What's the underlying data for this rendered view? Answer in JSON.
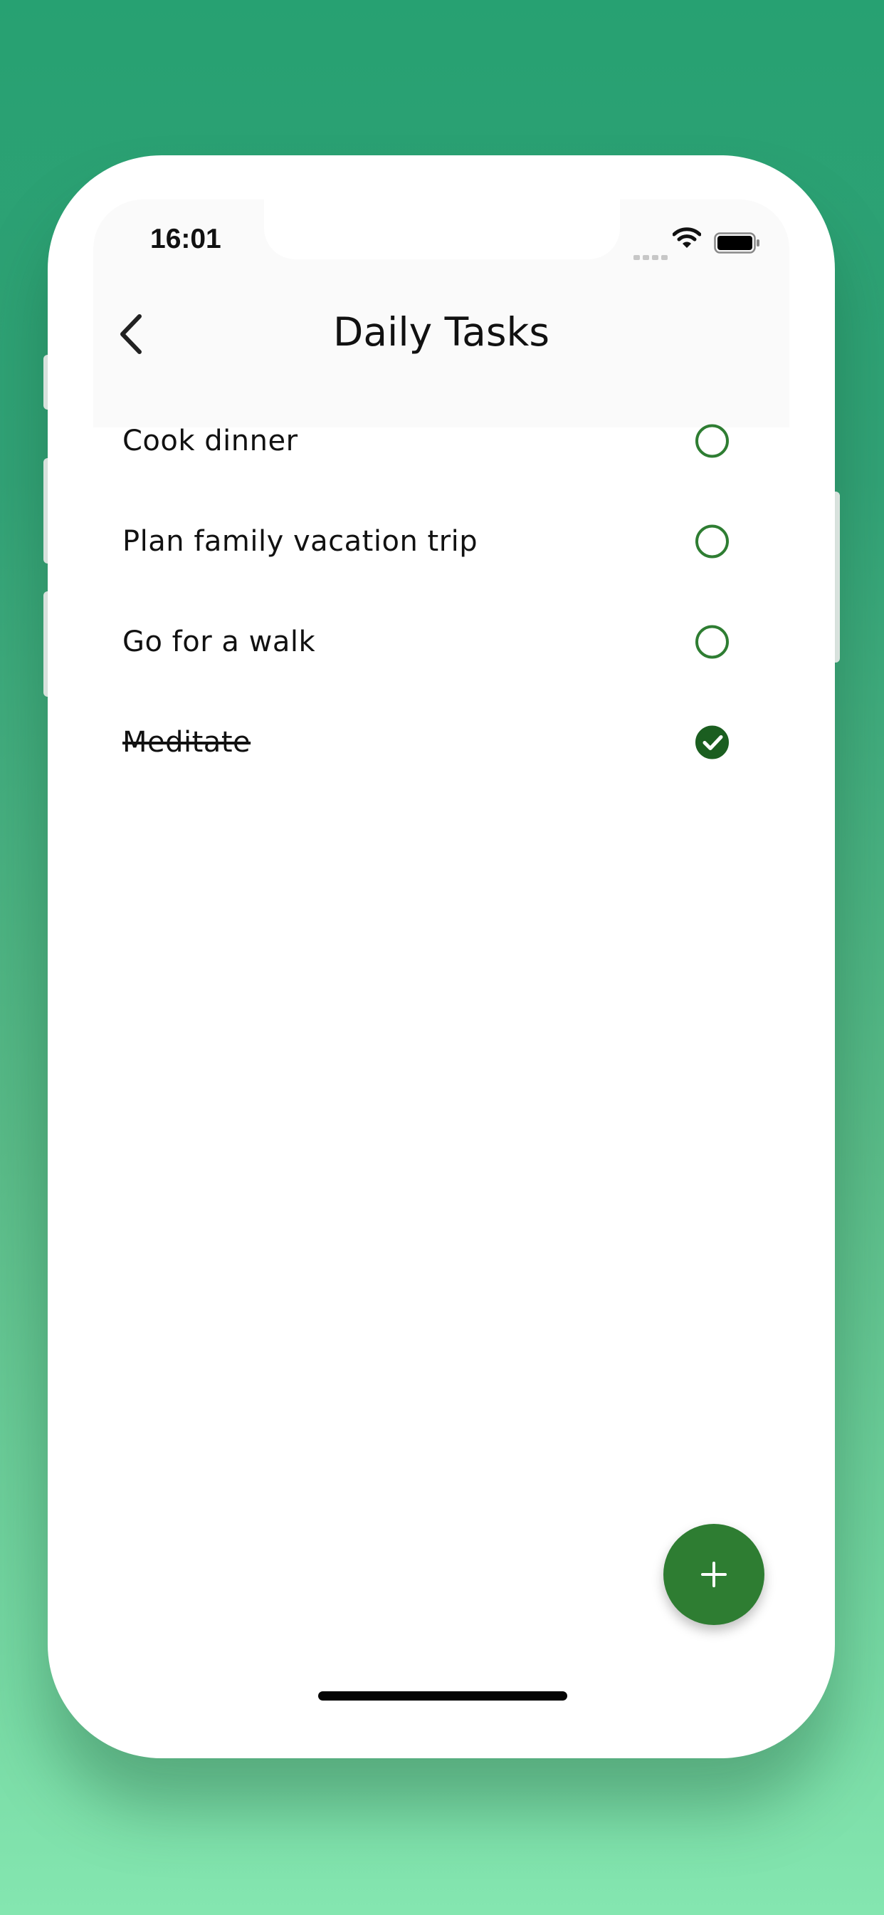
{
  "status_bar": {
    "time": "16:01"
  },
  "header": {
    "title": "Daily Tasks"
  },
  "tasks": [
    {
      "label": "Cook dinner",
      "done": false
    },
    {
      "label": "Plan family vacation trip",
      "done": false
    },
    {
      "label": "Go for a walk",
      "done": false
    },
    {
      "label": "Meditate",
      "done": true
    }
  ],
  "icons": {
    "back": "chevron-left-icon",
    "add": "plus-icon",
    "check": "checkmark-icon",
    "wifi": "wifi-icon",
    "battery": "battery-icon"
  },
  "colors": {
    "accent": "#2e7d32",
    "accent_dark": "#1b5e20",
    "background_top": "#27a172",
    "background_bottom": "#84e6b0"
  }
}
